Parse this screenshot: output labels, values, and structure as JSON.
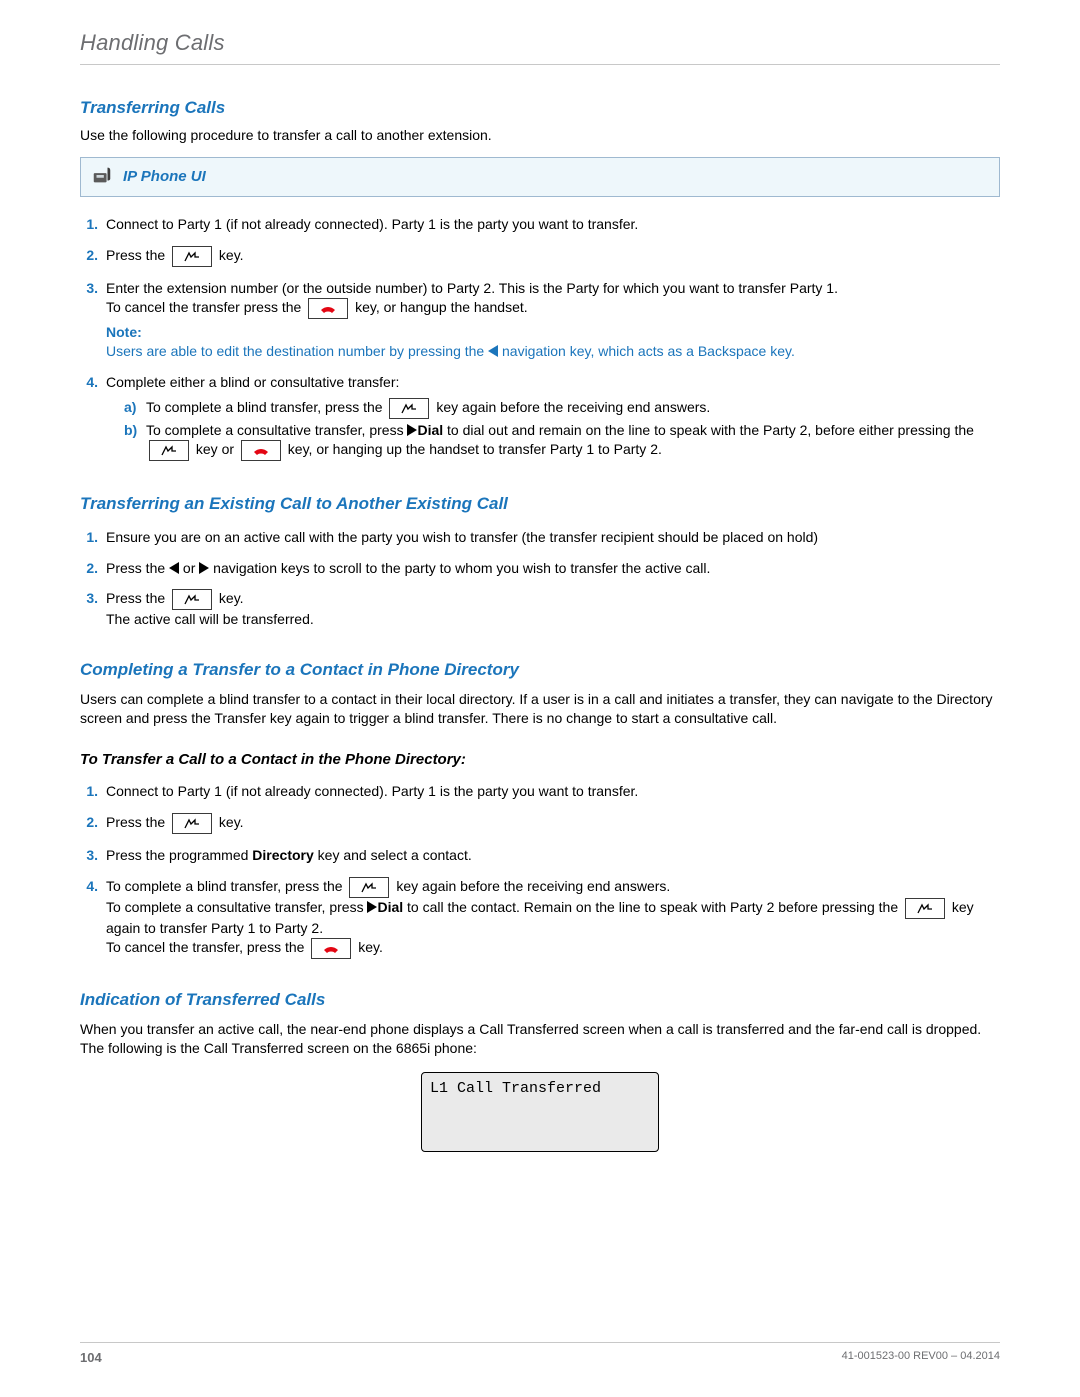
{
  "header": "Handling Calls",
  "s1": {
    "title": "Transferring Calls",
    "intro": "Use the following procedure to transfer a call to another extension."
  },
  "callout": {
    "label": "IP Phone UI"
  },
  "steps1": {
    "n1": "1.",
    "t1": "Connect to Party 1 (if not already connected). Party 1 is the party you want to transfer.",
    "n2": "2.",
    "t2a": "Press the ",
    "t2b": " key.",
    "n3": "3.",
    "t3a": "Enter the extension number (or the outside number) to Party 2. This is the Party for which you want to transfer Party 1.",
    "t3b1": "To cancel the transfer press the ",
    "t3b2": " key, or hangup the handset.",
    "noteLabel": "Note:",
    "noteText1": "Users are able to edit the destination number by pressing the ",
    "noteText2": " navigation key, which acts as a Backspace key.",
    "n4": "4.",
    "t4": "Complete either a blind or consultative transfer:",
    "sa": "a)",
    "saT1": "To complete a blind transfer, press the ",
    "saT2": " key again before the receiving end answers.",
    "sb": "b)",
    "sbT1": "To complete a consultative transfer, press ",
    "sbDial": "Dial",
    "sbT2": " to dial out and remain on the line to speak with the Party 2, before either pressing the ",
    "sbT3": " key or ",
    "sbT4": " key, or hanging up the handset to transfer Party 1 to Party 2."
  },
  "s2": {
    "title": "Transferring an Existing Call to Another Existing Call"
  },
  "steps2": {
    "n1": "1.",
    "t1": "Ensure you are on an active call with the party you wish to transfer (the transfer recipient should be placed on hold)",
    "n2": "2.",
    "t2a": "Press the ",
    "t2b": " or ",
    "t2c": " navigation keys to scroll to the party to whom you wish to transfer the active call.",
    "n3": "3.",
    "t3a": "Press the ",
    "t3b": " key.",
    "t3c": "The active call will be transferred."
  },
  "s3": {
    "title": "Completing a Transfer to a Contact in Phone Directory",
    "intro": "Users can complete a blind transfer to a contact in their local directory. If a user is in a call and initiates a transfer, they can navigate to the Directory screen and press the Transfer key again to trigger a blind transfer. There is no change to start a consultative call.",
    "minor": "To Transfer a Call to a Contact in the Phone Directory:"
  },
  "steps3": {
    "n1": "1.",
    "t1": "Connect to Party 1 (if not already connected). Party 1 is the party you want to transfer.",
    "n2": "2.",
    "t2a": "Press the ",
    "t2b": " key.",
    "n3": "3.",
    "t3a": "Press the programmed ",
    "t3dir": "Directory",
    "t3b": " key and select a contact.",
    "n4": "4.",
    "t4a": "To complete a blind transfer, press the ",
    "t4b": " key  again before the receiving end answers.",
    "t4c1": "To complete a consultative transfer, press ",
    "t4dial": "Dial",
    "t4c2": " to call the contact. Remain on the line to speak with Party 2 before pressing the ",
    "t4c3": " key again to transfer Party 1 to Party 2.",
    "t4d1": "To cancel the transfer, press the ",
    "t4d2": " key."
  },
  "s4": {
    "title": "Indication of Transferred Calls",
    "intro": "When you transfer an active call, the near-end phone displays a Call Transferred screen when a call is transferred and the far-end call is dropped. The following is the Call Transferred screen on the 6865i phone:",
    "screen": "L1 Call Transferred"
  },
  "footer": {
    "page": "104",
    "doc": "41-001523-00 REV00 – 04.2014"
  },
  "icons": {
    "transfer": "transfer-key",
    "hangup": "hangup-key",
    "phone": "ip-phone"
  }
}
